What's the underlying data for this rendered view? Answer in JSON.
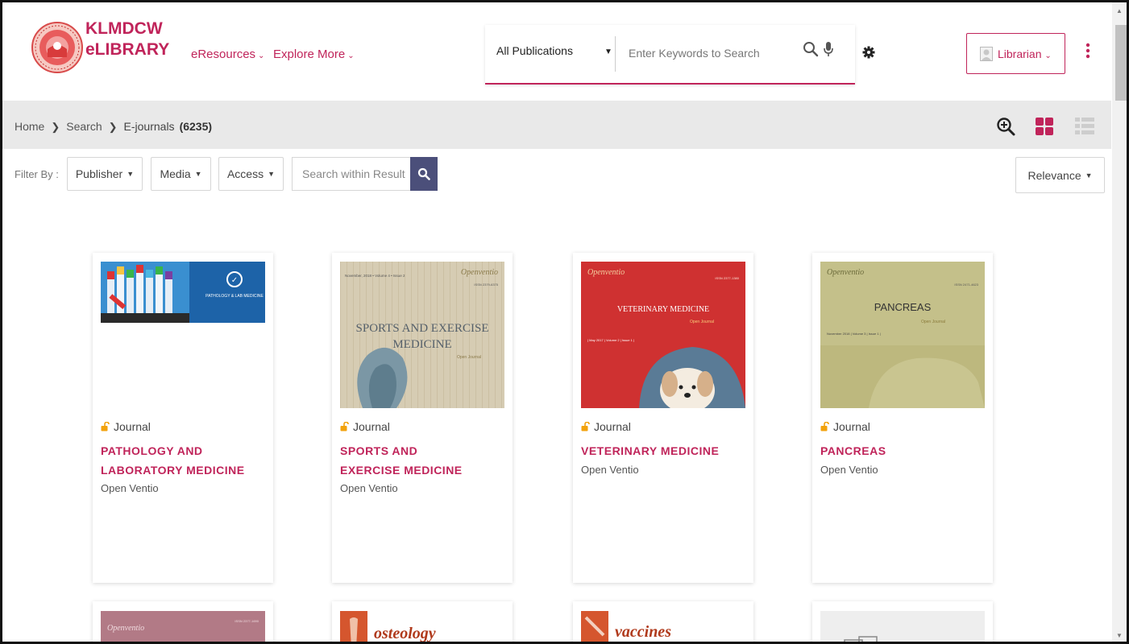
{
  "header": {
    "brand_line1": "KLMDCW",
    "brand_line2": "eLIBRARY",
    "nav": [
      {
        "label": "eResources"
      },
      {
        "label": "Explore More"
      }
    ],
    "search": {
      "scope": "All Publications",
      "placeholder": "Enter Keywords to Search"
    },
    "user_label": "Librarian"
  },
  "breadcrumb": {
    "items": [
      "Home",
      "Search",
      "E-journals"
    ],
    "count": "(6235)"
  },
  "filters": {
    "label": "Filter By :",
    "buttons": [
      "Publisher",
      "Media",
      "Access"
    ],
    "within_placeholder": "Search within Result",
    "sort": "Relevance"
  },
  "cards": [
    {
      "type": "Journal",
      "title": "PATHOLOGY AND LABORATORY MEDICINE",
      "publisher": "Open Ventio",
      "cover_text": [
        "PATHOLOGY & LAB MEDICINE"
      ]
    },
    {
      "type": "Journal",
      "title": "SPORTS AND EXERCISE MEDICINE",
      "publisher": "Open Ventio",
      "cover_text": [
        "November, 2018 • Volume 4 • Issue 2",
        "Openventio",
        "ISSN 2379-6375",
        "SPORTS AND EXERCISE",
        "MEDICINE",
        "Open Journal"
      ]
    },
    {
      "type": "Journal",
      "title": "VETERINARY MEDICINE",
      "publisher": "Open Ventio",
      "cover_text": [
        "Openventio",
        "ISSN 2377-1380",
        "VETERINARY MEDICINE",
        "Open Journal",
        "| May 2017 | Volume 2 | Issue 1 |"
      ]
    },
    {
      "type": "Journal",
      "title": "PANCREAS",
      "publisher": "Open Ventio",
      "cover_text": [
        "Openventio",
        "ISSN 2471-4623",
        "PANCREAS",
        "Open Journal",
        "November 2018 | Volume 3 | Issue 1 |"
      ]
    }
  ],
  "cards_row2": [
    {
      "cover_text": [
        "Openventio",
        "ISSN 2377-1690"
      ]
    },
    {
      "cover_text": [
        "osteology"
      ]
    },
    {
      "cover_text": [
        "vaccines"
      ]
    },
    {
      "cover_text": []
    }
  ],
  "colors": {
    "accent": "#c0245a",
    "search_button": "#4b4f7a",
    "crumb_bar": "#e9e9e9"
  }
}
